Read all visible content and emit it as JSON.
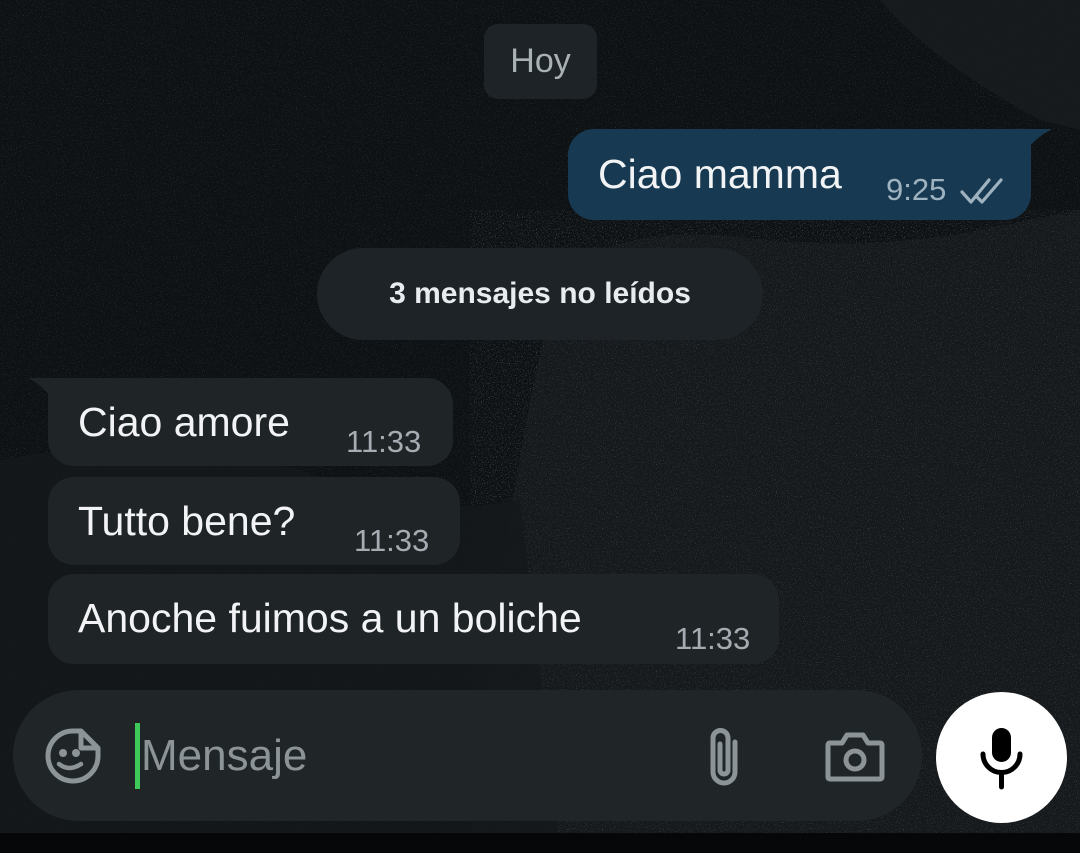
{
  "date_separator": "Hoy",
  "unread_banner": "3 mensajes no leídos",
  "messages": [
    {
      "direction": "outgoing",
      "text": "Ciao mamma",
      "time": "9:25",
      "status": "read-double-check"
    },
    {
      "direction": "incoming",
      "text": "Ciao amore",
      "time": "11:33"
    },
    {
      "direction": "incoming",
      "text": "Tutto bene?",
      "time": "11:33"
    },
    {
      "direction": "incoming",
      "text": "Anoche fuimos a un boliche",
      "time": "11:33"
    }
  ],
  "composer": {
    "placeholder": "Mensaje",
    "value": "",
    "icons": [
      "sticker-icon",
      "paperclip-icon",
      "camera-icon",
      "microphone-icon"
    ]
  },
  "colors": {
    "background": "#0e1214",
    "outgoing_bubble": "#173a52",
    "incoming_bubble": "#1f2427",
    "composer": "#202628",
    "caret": "#3ec85a"
  }
}
